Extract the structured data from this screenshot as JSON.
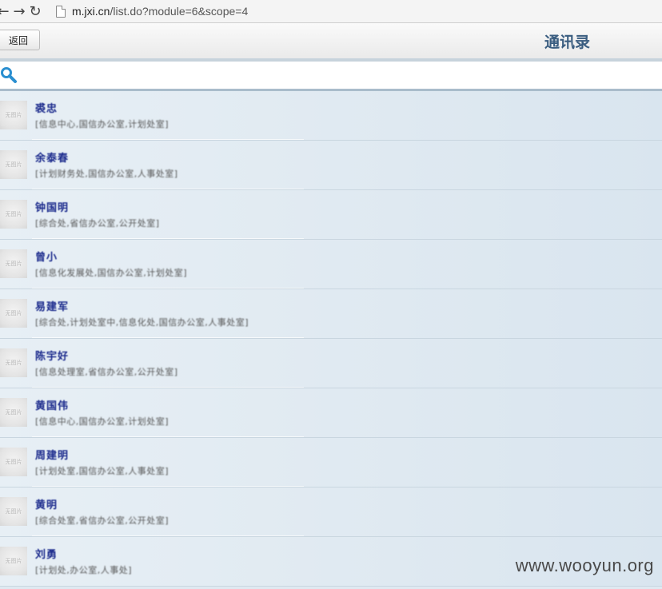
{
  "browser": {
    "url_host": "m.jxi.cn",
    "url_path": "/list.do?module=6&scope=4"
  },
  "header": {
    "back_label": "返回",
    "title": "通讯录"
  },
  "search": {
    "placeholder": ""
  },
  "contacts": [
    {
      "avatar": "无图片",
      "name": "裘忠",
      "info": "[信息中心,国信办公室,计划处室]"
    },
    {
      "avatar": "无图片",
      "name": "余泰春",
      "info": "[计划财务处,国信办公室,人事处室]"
    },
    {
      "avatar": "无图片",
      "name": "钟国明",
      "info": "[综合处,省信办公室,公开处室]"
    },
    {
      "avatar": "无图片",
      "name": "曾小",
      "info": "[信息化发展处,国信办公室,计划处室]"
    },
    {
      "avatar": "无图片",
      "name": "易建军",
      "info": "[综合处,计划处室中,信息化处,国信办公室,人事处室]"
    },
    {
      "avatar": "无图片",
      "name": "陈宇好",
      "info": "[信息处理室,省信办公室,公开处室]"
    },
    {
      "avatar": "无图片",
      "name": "黄国伟",
      "info": "[信息中心,国信办公室,计划处室]"
    },
    {
      "avatar": "无图片",
      "name": "周建明",
      "info": "[计划处室,国信办公室,人事处室]"
    },
    {
      "avatar": "无图片",
      "name": "黄明",
      "info": "[综合处室,省信办公室,公开处室]"
    },
    {
      "avatar": "无图片",
      "name": "刘勇",
      "info": "[计划处,办公室,人事处]"
    }
  ],
  "watermark": "www.wooyun.org"
}
